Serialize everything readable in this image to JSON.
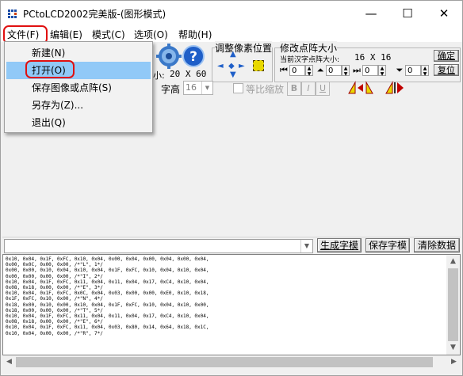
{
  "window": {
    "title": "PCtoLCD2002完美版-(图形模式)",
    "minimize_glyph": "—",
    "maximize_glyph": "☐",
    "close_glyph": "✕"
  },
  "menubar": {
    "items": [
      "文件(F)",
      "编辑(E)",
      "模式(C)",
      "选项(O)",
      "帮助(H)"
    ]
  },
  "file_menu": {
    "items": [
      "新建(N)",
      "打开(O)",
      "保存图像或点阵(S)",
      "另存为(Z)...",
      "退出(Q)"
    ],
    "highlighted_index": 1
  },
  "toolbar": {
    "size_prefix": "小:",
    "size_value": "20 X 60",
    "font_height_label": "字高",
    "font_height_value": "16",
    "proportional_label": "等比缩放",
    "bold_label": "B",
    "italic_label": "I",
    "underline_label": "U",
    "adjust_pixel_title": "调整像素位置",
    "modify_matrix_title": "修改点阵大小",
    "current_size_label": "当前汉字点阵大小:",
    "current_size_value": "16 X 16",
    "confirm_button": "确定",
    "restore_button": "复位",
    "spin_values": [
      "0",
      "0",
      "0",
      "0"
    ]
  },
  "bottombar": {
    "generate_button": "生成字模",
    "save_button": "保存字模",
    "clear_button": "清除数据"
  },
  "output": {
    "lines": [
      "0x10, 0x04, 0x1F, 0xFC, 0x10, 0x04, 0x00, 0x04, 0x00, 0x04, 0x00, 0x04,",
      "0x00, 0x0C, 0x00, 0x00, /*\"L\", 1*/",
      "0x00, 0x00, 0x10, 0x04, 0x10, 0x04, 0x1F, 0xFC, 0x10, 0x04, 0x10, 0x04,",
      "0x00, 0x00, 0x00, 0x00, /*\"I\", 2*/",
      "0x10, 0x04, 0x1F, 0xFC, 0x11, 0x04, 0x11, 0x04, 0x17, 0xC4, 0x10, 0x04,",
      "0x08, 0x18, 0x00, 0x00, /*\"E\", 3*/",
      "0x10, 0x04, 0x1F, 0xFC, 0x0C, 0x04, 0x03, 0x00, 0x00, 0xE0, 0x10, 0x18,",
      "0x1F, 0xFC, 0x10, 0x00, /*\"N\", 4*/",
      "0x18, 0x00, 0x10, 0x00, 0x10, 0x04, 0x1F, 0xFC, 0x10, 0x04, 0x10, 0x00,",
      "0x18, 0x00, 0x00, 0x00, /*\"T\", 5*/",
      "0x10, 0x04, 0x1F, 0xFC, 0x11, 0x04, 0x11, 0x04, 0x17, 0xC4, 0x10, 0x04,",
      "0x08, 0x18, 0x00, 0x00, /*\"E\", 6*/",
      "0x10, 0x04, 0x1F, 0xFC, 0x11, 0x04, 0x03, 0x80, 0x14, 0x64, 0x18, 0x1C,",
      "0x10, 0x04, 0x00, 0x00, /*\"R\", 7*/"
    ]
  },
  "colors": {
    "highlight": "#91c9f7",
    "annotation_red": "#e01010",
    "window_bg": "#f0f0f0"
  }
}
